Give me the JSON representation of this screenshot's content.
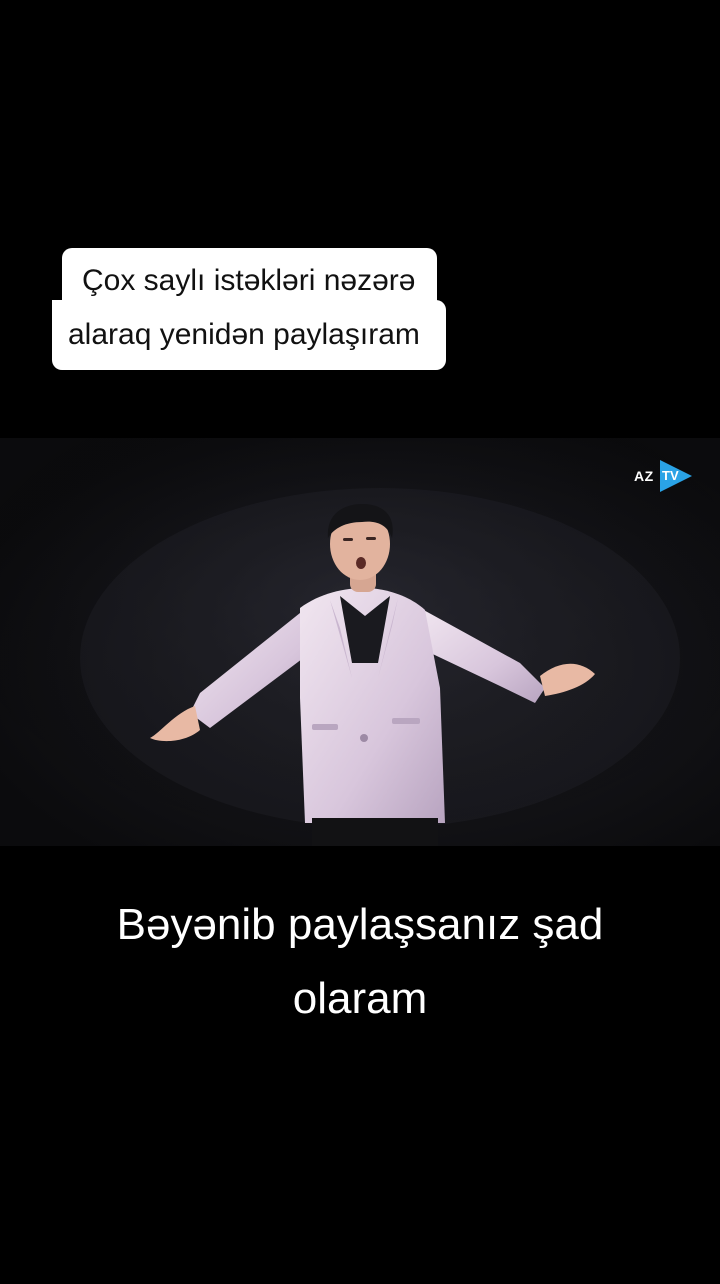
{
  "top_caption": {
    "line1": "Çox saylı istəkləri nəzərə",
    "line2": "alaraq yenidən paylaşıram"
  },
  "video": {
    "logo": {
      "left_text": "AZ",
      "right_text": "TV",
      "accent_color": "#2aa3e6"
    }
  },
  "bottom_caption": {
    "line1": "Bəyənib paylaşsanız şad",
    "line2": "olaram"
  }
}
